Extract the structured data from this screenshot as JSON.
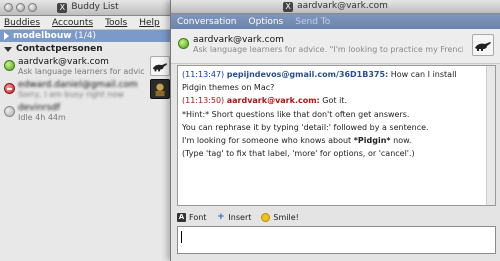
{
  "buddy_list": {
    "title": "Buddy List",
    "menu": [
      "Buddies",
      "Accounts",
      "Tools",
      "Help"
    ],
    "groups": [
      {
        "name": "modelbouw",
        "count": "(1/4)"
      },
      {
        "name": "Contactpersonen"
      }
    ],
    "buddies": [
      {
        "name": "aardvark@vark.com",
        "message": "Ask language learners for advice. \"I'm lo"
      },
      {
        "name": "edward.daniel@gmail.com",
        "message": "Sorry, I am busy right now"
      },
      {
        "name": "devinrsdf",
        "message": "Idle 4h 44m"
      }
    ]
  },
  "conversation": {
    "title": "aardvark@vark.com",
    "menu": [
      "Conversation",
      "Options",
      "Send To"
    ],
    "header": {
      "name": "aardvark@vark.com",
      "message": "Ask language learners for advice. \"I'm looking to practice my French---I'm"
    },
    "log": [
      {
        "time": "(11:13:47)",
        "nick": "pepijndevos@gmail.com/36D1B375:",
        "text": " How can I install"
      },
      {
        "text": "Pidgin themes on Mac?"
      },
      {
        "time": "(11:13:50)",
        "nick": "aardvark@vark.com:",
        "text": " Got it."
      },
      {
        "text": "*Hint:* Short questions like that don't often get answers."
      },
      {
        "text": "You can rephrase it by typing 'detail:' followed by a sentence."
      },
      {
        "text_pre": "I'm looking for someone who knows about ",
        "bold": "*Pidgin*",
        "text_post": " now."
      },
      {
        "text": "(Type 'tag' to fix that label, 'more' for options, or 'cancel'.)"
      }
    ],
    "toolbar": {
      "font": "Font",
      "insert": "Insert",
      "smile": "Smile!"
    },
    "entry_value": ""
  },
  "icons": {
    "status_available": "status-available-icon",
    "status_busy": "status-busy-icon",
    "status_idle": "status-idle-icon",
    "buddy_icon_aardvark": "aardvark-icon",
    "x11_logo": "x11-icon"
  },
  "colors": {
    "selected_group": "#7b99c9",
    "conv_menubar": "#6b84ad",
    "timestamp_blue": "#0a3aa3",
    "nick_red": "#b31414"
  }
}
